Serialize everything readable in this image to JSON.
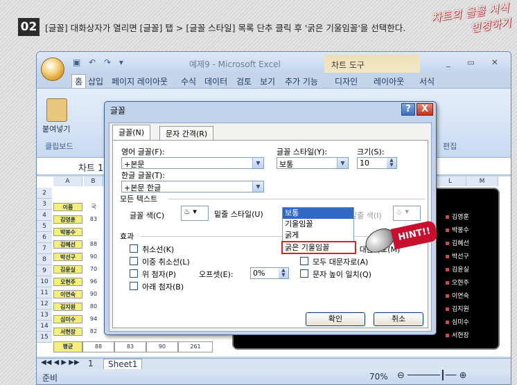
{
  "step": {
    "number": "02",
    "instruction": "[글꼴] 대화상자가 열리면 [글꼴] 탭 > [글꼴 스타일] 목록 단추 클릭 후 '굵은 기울임꼴'을 선택한다.",
    "handwriting_line1": "차트의 글꼴 서식",
    "handwriting_line2": "변경하기"
  },
  "excel": {
    "title": "예제9 - Microsoft Excel",
    "chart_tools": "차트 도구",
    "tabs": [
      "홈",
      "삽입",
      "페이지 레이아웃",
      "수식",
      "데이터",
      "검토",
      "보기",
      "추가 기능",
      "디자인",
      "레이아웃",
      "서식"
    ],
    "paste_label": "붙여넣기",
    "clipboard_label": "클립보드",
    "edit_label": "편집",
    "name_box": "차트 1",
    "columns": [
      "A",
      "B",
      "L",
      "M"
    ],
    "rows": [
      "2",
      "3",
      "4",
      "5",
      "6",
      "7",
      "8",
      "9",
      "10",
      "11",
      "12",
      "13",
      "14",
      "15"
    ],
    "names": [
      "이름",
      "김영훈",
      "박봉수",
      "김혜선",
      "박선구",
      "김윤실",
      "오현주",
      "이연숙",
      "김지원",
      "심미수",
      "서현장"
    ],
    "col_b": [
      "국",
      "83",
      "",
      "88",
      "90",
      "70",
      "96",
      "90",
      "80",
      "94",
      "82"
    ],
    "total_label": "평균",
    "totals": [
      "88",
      "83",
      "90",
      "261"
    ],
    "legend": [
      "김영훈",
      "박봉수",
      "김혜선",
      "박선구",
      "김윤실",
      "오현주",
      "이연숙",
      "김지원",
      "심미수",
      "서현장"
    ],
    "sheet_page": "1",
    "sheet_tab": "Sheet1",
    "status_left": "준비",
    "zoom": "70%"
  },
  "dialog": {
    "title": "글꼴",
    "help": "?",
    "close": "X",
    "tab_font": "글꼴(N)",
    "tab_spacing": "문자 간격(R)",
    "latin_label": "영어 글꼴(F):",
    "latin_value": "+본문",
    "hangul_label": "한글 글꼴(T):",
    "hangul_value": "+본문 한글",
    "style_label": "글꼴 스타일(Y):",
    "style_value": "보통",
    "size_label": "크기(S):",
    "size_value": "10",
    "style_options": [
      "보통",
      "기울임꼴",
      "굵게",
      "굵은 기울임꼴"
    ],
    "all_text": "모든 텍스트",
    "font_color": "글꼴 색(C)",
    "underline_style": "밑줄 스타일(U)",
    "underline_color": "밑줄 색(I)",
    "effects": "효과",
    "strikethrough": "취소선(K)",
    "double_strike": "이중 취소선(L)",
    "superscript": "위 첨자(P)",
    "offset_label": "오프셋(E):",
    "offset_value": "0%",
    "subscript": "아래 첨자(B)",
    "small_caps": "소문자를 작은 대문자로(M)",
    "all_caps": "모두 대문자로(A)",
    "equalize": "문자 높이 일치(Q)",
    "ok": "확인",
    "cancel": "취소"
  },
  "hint": "HINT!!"
}
